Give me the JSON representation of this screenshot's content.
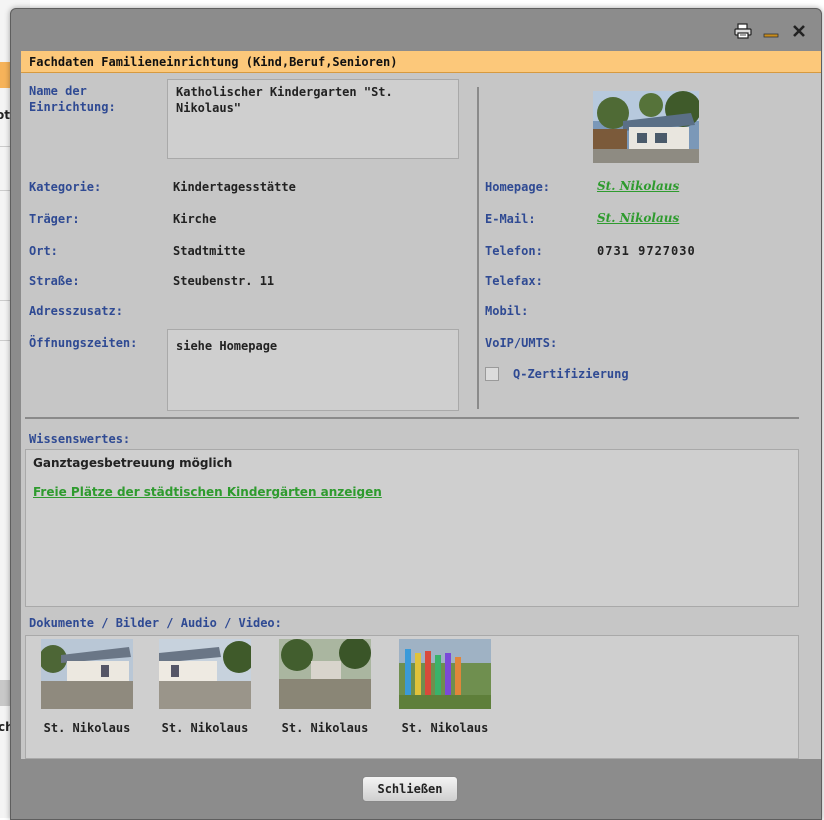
{
  "background_app": {
    "peek_top": "ot",
    "peek_bottom": "ch"
  },
  "window": {
    "title": "Fachdaten Familieneinrichtung (Kind,Beruf,Senioren)",
    "controls": [
      "printer-icon",
      "minimize-icon",
      "close-icon"
    ]
  },
  "left": {
    "name_label": "Name der Einrichtung:",
    "name_value": "Katholischer Kindergarten \"St. Nikolaus\"",
    "kategorie_label": "Kategorie:",
    "kategorie_value": "Kindertagesstätte",
    "traeger_label": "Träger:",
    "traeger_value": "Kirche",
    "ort_label": "Ort:",
    "ort_value": "Stadtmitte",
    "strasse_label": "Straße:",
    "strasse_value": "Steubenstr. 11",
    "adresszusatz_label": "Adresszusatz:",
    "adresszusatz_value": "",
    "oeffnungszeiten_label": "Öffnungszeiten:",
    "oeffnungszeiten_value": "siehe Homepage"
  },
  "right": {
    "homepage_label": "Homepage:",
    "homepage_value": "St. Nikolaus",
    "email_label": "E-Mail:",
    "email_value": "St. Nikolaus",
    "telefon_label": "Telefon:",
    "telefon_value": "0731 9727030",
    "telefax_label": "Telefax:",
    "telefax_value": "",
    "mobil_label": "Mobil:",
    "mobil_value": "",
    "voip_label": "VoIP/UMTS:",
    "voip_value": "",
    "qzert_label": "Q-Zertifizierung",
    "qzert_checked": false
  },
  "wissenswertes": {
    "label": "Wissenswertes:",
    "text": "Ganztagesbetreuung möglich",
    "link": "Freie Plätze der städtischen Kindergärten anzeigen"
  },
  "documents": {
    "label": "Dokumente / Bilder / Audio / Video:",
    "items": [
      {
        "caption": "St. Nikolaus"
      },
      {
        "caption": "St. Nikolaus"
      },
      {
        "caption": "St. Nikolaus"
      },
      {
        "caption": "St. Nikolaus"
      }
    ]
  },
  "footer": {
    "close_label": "Schließen"
  },
  "colors": {
    "title_bar": "#fcc87a",
    "label_blue": "#2f4a93",
    "link_green": "#2e9b2e",
    "panel": "#c6c6c6",
    "dialog_frame": "#8c8c8c"
  }
}
